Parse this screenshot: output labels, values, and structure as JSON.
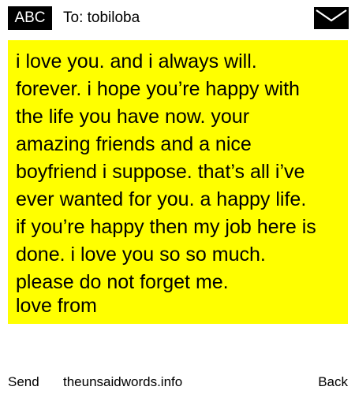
{
  "header": {
    "mode_label": "ABC",
    "recipient": "To: tobiloba",
    "envelope_icon": "envelope-icon"
  },
  "message": {
    "background": "#ffff00",
    "body": "i love you. and i always will.\nforever. i hope you’re happy with\nthe life you have now. your\namazing friends and a nice\nboyfriend i suppose. that’s all i’ve\never wanted for you. a happy life.\nif you’re happy then my job here is\ndone. i love you so so much.\nplease do not forget me.",
    "sign_off": "love from"
  },
  "footer": {
    "send_label": "Send",
    "site_label": "theunsaidwords.info",
    "back_label": "Back"
  }
}
